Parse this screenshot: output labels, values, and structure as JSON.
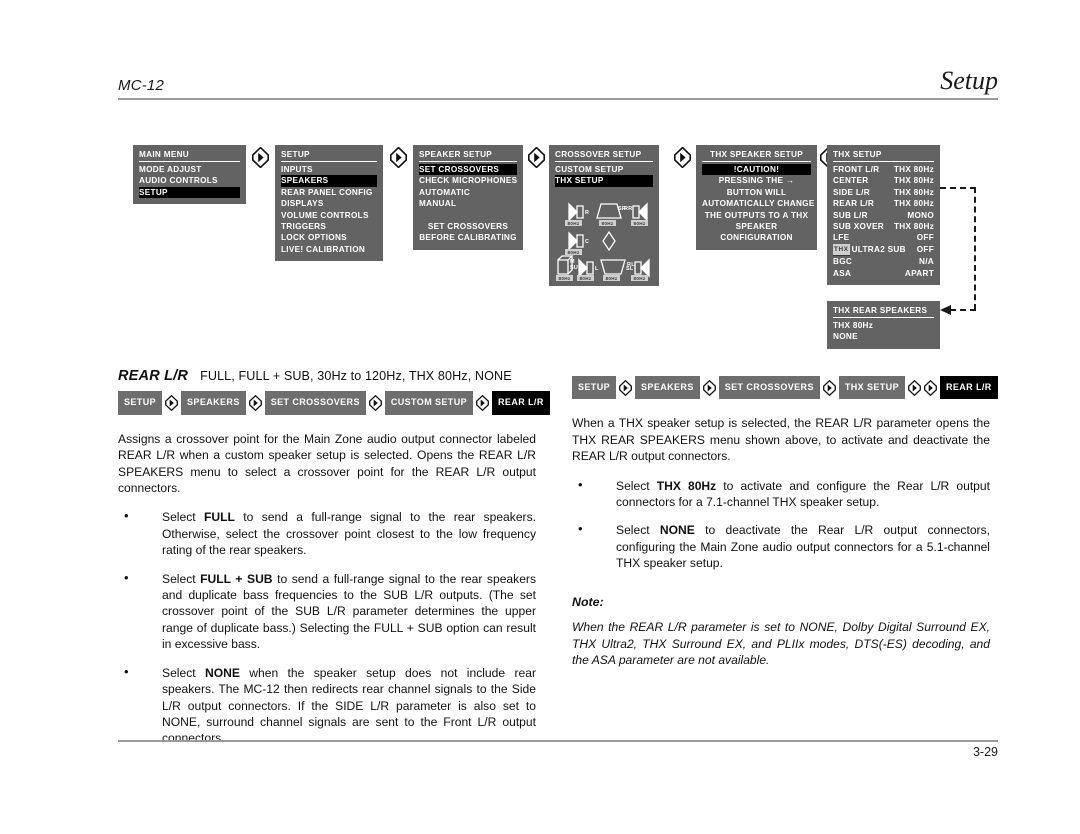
{
  "header": {
    "model": "MC-12",
    "section": "Setup"
  },
  "footer": {
    "page": "3-29"
  },
  "flow": {
    "arrow_icon": "chevron-right-icon",
    "menus": [
      {
        "id": "main-menu",
        "title": "MAIN MENU",
        "rows": [
          {
            "label": "MODE ADJUST",
            "selected": false
          },
          {
            "label": "AUDIO CONTROLS",
            "selected": false
          },
          {
            "label": "SETUP",
            "selected": true
          }
        ]
      },
      {
        "id": "setup",
        "title": "SETUP",
        "rows": [
          {
            "label": "INPUTS",
            "selected": false
          },
          {
            "label": "SPEAKERS",
            "selected": true
          },
          {
            "label": "REAR PANEL CONFIG",
            "selected": false
          },
          {
            "label": "DISPLAYS",
            "selected": false
          },
          {
            "label": "VOLUME CONTROLS",
            "selected": false
          },
          {
            "label": "TRIGGERS",
            "selected": false
          },
          {
            "label": "LOCK OPTIONS",
            "selected": false
          },
          {
            "label": "LIVE! CALIBRATION",
            "selected": false
          }
        ]
      },
      {
        "id": "speaker-setup",
        "title": "SPEAKER SETUP",
        "rows": [
          {
            "label": "SET CROSSOVERS",
            "selected": true
          },
          {
            "label": "CHECK MICROPHONES",
            "selected": false
          },
          {
            "label": "AUTOMATIC",
            "selected": false
          },
          {
            "label": "MANUAL",
            "selected": false
          }
        ],
        "notice": [
          "SET CROSSOVERS",
          "BEFORE CALIBRATING"
        ]
      },
      {
        "id": "crossover-setup",
        "title": "CROSSOVER SETUP",
        "rows": [
          {
            "label": "CUSTOM SETUP",
            "selected": false
          },
          {
            "label": "THX SETUP",
            "selected": true
          }
        ],
        "speaker_graphic": {
          "speakers": [
            {
              "name": "R",
              "value": "80Hz"
            },
            {
              "name": "SR",
              "value": "80Hz"
            },
            {
              "name": "RR",
              "value": "80Hz"
            },
            {
              "name": "C",
              "value": "80Hz"
            },
            {
              "name": "M SUB",
              "value": "80Hz"
            },
            {
              "name": "L",
              "value": "80Hz"
            },
            {
              "name": "SL",
              "value": "80Hz"
            },
            {
              "name": "RL",
              "value": "80Hz"
            }
          ]
        }
      },
      {
        "id": "thx-speaker-setup",
        "title": "THX SPEAKER SETUP",
        "rows": [
          {
            "label": "!CAUTION!",
            "selected": true
          }
        ],
        "caution_lines": [
          "PRESSING THE →",
          "BUTTON WILL",
          "AUTOMATICALLY CHANGE",
          "THE OUTPUTS TO A THX",
          "SPEAKER",
          "CONFIGURATION"
        ]
      },
      {
        "id": "thx-setup",
        "title": "THX SETUP",
        "entries": [
          {
            "key": "FRONT L/R",
            "value": "THX 80Hz"
          },
          {
            "key": "CENTER",
            "value": "THX 80Hz"
          },
          {
            "key": "SIDE L/R",
            "value": "THX 80Hz"
          },
          {
            "key": "REAR L/R",
            "value": "THX 80Hz"
          },
          {
            "key": "SUB L/R",
            "value": "MONO"
          },
          {
            "key": "SUB XOVER",
            "value": "THX 80Hz"
          },
          {
            "key": "LFE",
            "value": "OFF"
          },
          {
            "key": "ULTRA2 SUB",
            "value": "OFF",
            "thx_logo": true
          },
          {
            "key": "BGC",
            "value": "N/A"
          },
          {
            "key": "ASA",
            "value": "APART"
          }
        ]
      },
      {
        "id": "thx-rear-speakers",
        "title": "THX REAR SPEAKERS",
        "rows": [
          {
            "label": "THX 80Hz",
            "selected": false
          },
          {
            "label": "NONE",
            "selected": false
          }
        ]
      }
    ]
  },
  "left_column": {
    "param_name": "REAR L/R",
    "param_values": "FULL, FULL + SUB, 30Hz to 120Hz, THX 80Hz, NONE",
    "breadcrumb": [
      "SETUP",
      "SPEAKERS",
      "SET CROSSOVERS",
      "CUSTOM SETUP",
      "REAR L/R"
    ],
    "intro": "Assigns a crossover point for the Main Zone audio output connector labeled REAR L/R when a custom speaker setup is selected. Opens the REAR L/R SPEAKERS menu to select a crossover point for the REAR L/R output connectors.",
    "bullets": [
      {
        "lead": "Select ",
        "bold": "FULL",
        "rest": " to send a full-range signal to the rear speakers. Otherwise, select the crossover point closest to the low frequency rating of the rear speakers."
      },
      {
        "lead": "Select ",
        "bold": "FULL + SUB",
        "rest": " to send a full-range signal to the rear speakers and duplicate bass frequencies to the SUB L/R outputs. (The set crossover point of the SUB L/R parameter determines the upper range of duplicate bass.) Selecting the FULL + SUB option can result in excessive bass."
      },
      {
        "lead": "Select ",
        "bold": "NONE",
        "rest": " when the speaker setup does not include rear speakers. The MC-12 then redirects rear channel signals to the Side L/R output connectors. If the SIDE L/R parameter is also set to NONE, surround channel signals are sent to the Front L/R output connectors."
      }
    ]
  },
  "right_column": {
    "breadcrumb": [
      "SETUP",
      "SPEAKERS",
      "SET CROSSOVERS",
      "THX SETUP",
      "REAR L/R"
    ],
    "intro": "When a THX speaker setup is selected, the REAR L/R parameter opens the THX REAR SPEAKERS menu shown above, to activate and deactivate the REAR L/R output connectors.",
    "bullets": [
      {
        "lead": "Select ",
        "bold": "THX 80Hz",
        "rest": " to activate and configure the Rear L/R output connectors for a 7.1-channel THX speaker setup."
      },
      {
        "lead": "Select ",
        "bold": "NONE",
        "rest": " to deactivate the Rear L/R output connectors, configuring the Main Zone audio output connectors for a 5.1-channel THX speaker setup."
      }
    ],
    "note_label": "Note:",
    "note_text": "When the REAR L/R parameter is set to NONE, Dolby Digital Surround EX, THX Ultra2, THX Surround EX, and PLIIx modes, DTS(-ES) decoding, and the ASA parameter are not available."
  },
  "colors": {
    "osd_background": "#636363",
    "osd_selected": "#000000",
    "chip": "#6e6e6e",
    "rule": "#9a9a9a"
  }
}
